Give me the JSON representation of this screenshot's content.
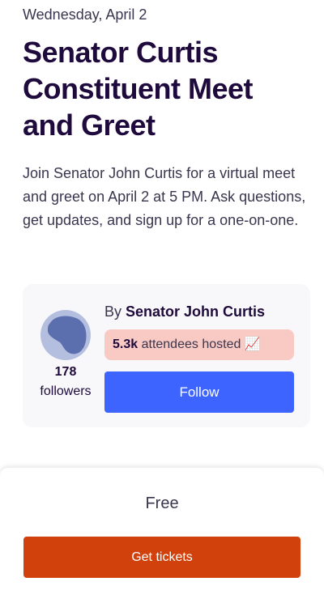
{
  "event": {
    "date": "Wednesday, April 2",
    "title": "Senator Curtis Constituent Meet and Greet",
    "description": "Join Senator John Curtis for a virtual meet and greet on April 2 at 5 PM. Ask questions, get updates, and sign up for a one-on-one."
  },
  "organizer": {
    "by_prefix": "By",
    "name": "Senator John Curtis",
    "followers_count": "178",
    "followers_label": "followers",
    "attendees_count": "5.3k",
    "attendees_text": "attendees hosted",
    "trend_emoji": "📈",
    "follow_label": "Follow",
    "avatar_icon": "avatar-blob-icon"
  },
  "tickets": {
    "price": "Free",
    "button_label": "Get tickets"
  },
  "colors": {
    "title": "#1e0a3c",
    "follow_button": "#3d64ff",
    "ticket_button": "#d1410c",
    "badge_background": "#f9c9c3",
    "card_background": "#f8f7fa",
    "avatar_background": "#b4bedf",
    "avatar_shape": "#5b6fae"
  }
}
